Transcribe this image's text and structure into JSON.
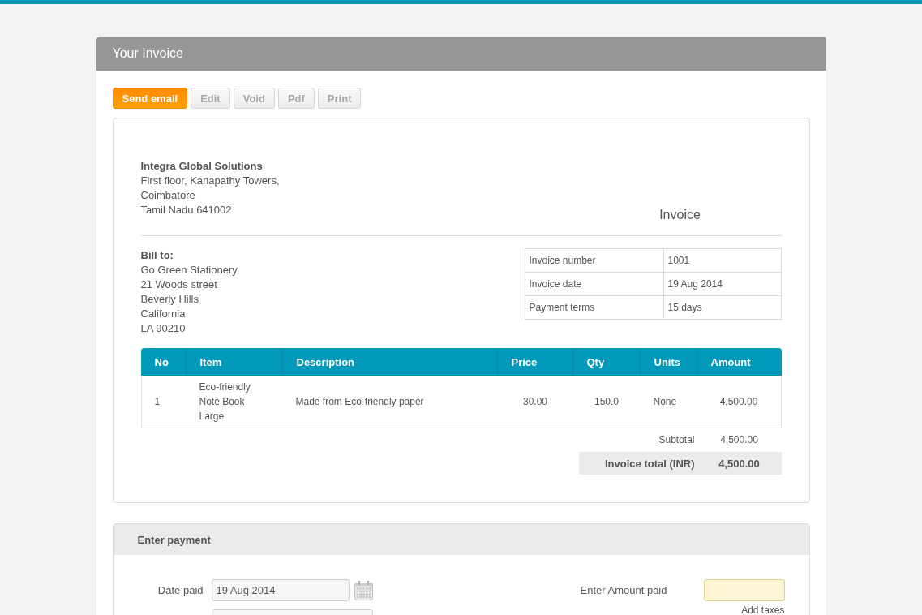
{
  "window": {
    "title": "Your Invoice"
  },
  "toolbar": [
    {
      "label": "Send email",
      "kind": "primary"
    },
    {
      "label": "Edit",
      "kind": "secondary"
    },
    {
      "label": "Void",
      "kind": "secondary"
    },
    {
      "label": "Pdf",
      "kind": "secondary"
    },
    {
      "label": "Print",
      "kind": "secondary"
    }
  ],
  "invoice": {
    "company": {
      "name": "Integra Global Solutions",
      "address": [
        "First floor, Kanapathy Towers,",
        "Coimbatore",
        "Tamil Nadu 641002"
      ]
    },
    "heading": "Invoice",
    "bill_to": {
      "label": "Bill to:",
      "lines": [
        "Go Green Stationery",
        "21 Woods street",
        "Beverly Hills",
        "California",
        "LA 90210"
      ]
    },
    "details": [
      {
        "label": "Invoice number",
        "value": "1001"
      },
      {
        "label": "Invoice date",
        "value": "19 Aug 2014"
      },
      {
        "label": "Payment terms",
        "value": "15 days"
      }
    ],
    "items": {
      "columns": [
        {
          "label": "No",
          "kind": "text"
        },
        {
          "label": "Item",
          "kind": "text"
        },
        {
          "label": "Description",
          "kind": "text"
        },
        {
          "label": "Price",
          "kind": "number"
        },
        {
          "label": "Qty",
          "kind": "number"
        },
        {
          "label": "Units",
          "kind": "text"
        },
        {
          "label": "Amount",
          "kind": "number"
        }
      ],
      "rows": [
        {
          "cells": [
            "1",
            "Eco-friendly\nNote Book\nLarge",
            "Made from Eco-friendly paper",
            "30.00",
            "150.0",
            "None",
            "4,500.00"
          ]
        }
      ]
    },
    "subtotal": {
      "label": "Subtotal",
      "value": "4,500.00"
    },
    "total": {
      "label": "Invoice total (INR)",
      "value": "4,500.00"
    }
  },
  "payment": {
    "title": "Enter payment",
    "left_fields": [
      {
        "kind": "date",
        "label": "Date paid",
        "value": "19 Aug 2014"
      },
      {
        "kind": "text"
      }
    ],
    "amount": {
      "label": "Enter Amount paid"
    },
    "add_taxes": "Add taxes"
  }
}
